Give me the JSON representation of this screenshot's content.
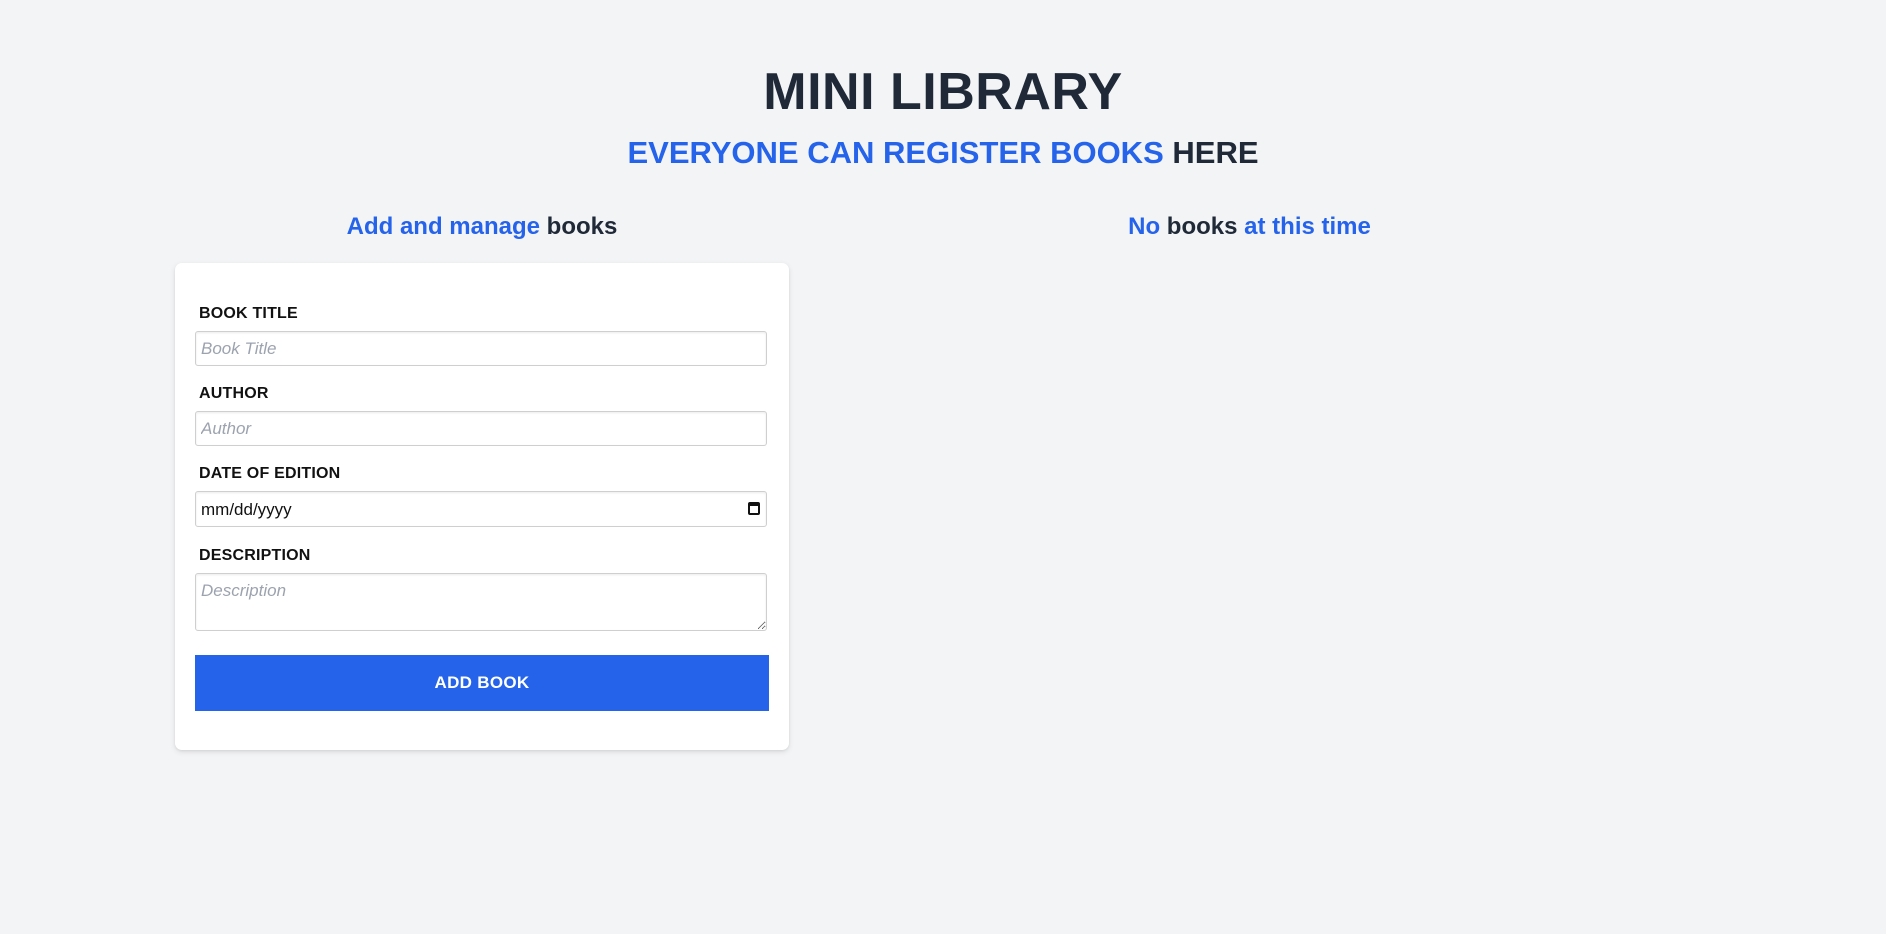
{
  "header": {
    "title": "MINI LIBRARY",
    "subtitle_accent": "EVERYONE CAN REGISTER BOOKS",
    "subtitle_rest": "HERE"
  },
  "form_section": {
    "heading_accent": "Add and manage",
    "heading_rest": "books"
  },
  "list_section": {
    "heading_part1": "No",
    "heading_part2": "books",
    "heading_part3": "at this time"
  },
  "form": {
    "title_label": "BOOK TITLE",
    "title_placeholder": "Book Title",
    "title_value": "",
    "author_label": "AUTHOR",
    "author_placeholder": "Author",
    "author_value": "",
    "date_label": "DATE OF EDITION",
    "date_display": "mm/dd/yyyy",
    "description_label": "DESCRIPTION",
    "description_placeholder": "Description",
    "description_value": "",
    "submit_label": "ADD BOOK"
  },
  "colors": {
    "accent": "#2563eb",
    "dark_text": "#1f2937",
    "background": "#f3f4f6",
    "card": "#ffffff"
  },
  "icons": {
    "date_picker": "calendar-icon"
  }
}
